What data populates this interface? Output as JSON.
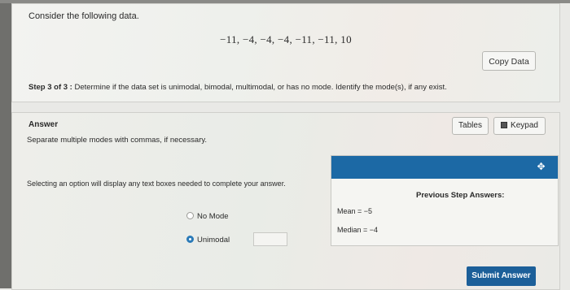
{
  "question": {
    "prompt": "Consider the following data.",
    "data_values": "−11, −4, −4, −4, −11, −11, 10",
    "copy_button": "Copy Data",
    "step_label": "Step 3 of 3 :",
    "step_text": " Determine if the data set is unimodal, bimodal, multimodal, or has no mode. Identify the mode(s), if any exist."
  },
  "answer": {
    "title": "Answer",
    "tables_button": "Tables",
    "keypad_button": "Keypad",
    "instruction": "Separate multiple modes with commas, if necessary.",
    "selecting_note": "Selecting an option will display any text boxes needed to complete your answer.",
    "options": [
      {
        "label": "No Mode",
        "selected": false
      },
      {
        "label": "Unimodal",
        "selected": true
      }
    ],
    "mode_input_value": ""
  },
  "previous_step": {
    "title": "Previous Step Answers:",
    "mean": "Mean = −5",
    "median": "Median = −4"
  },
  "submit_button": "Submit Answer",
  "colors": {
    "accent_blue": "#1c69a5",
    "submit_blue": "#1c5f99",
    "radio_selected": "#2a7ab8"
  }
}
